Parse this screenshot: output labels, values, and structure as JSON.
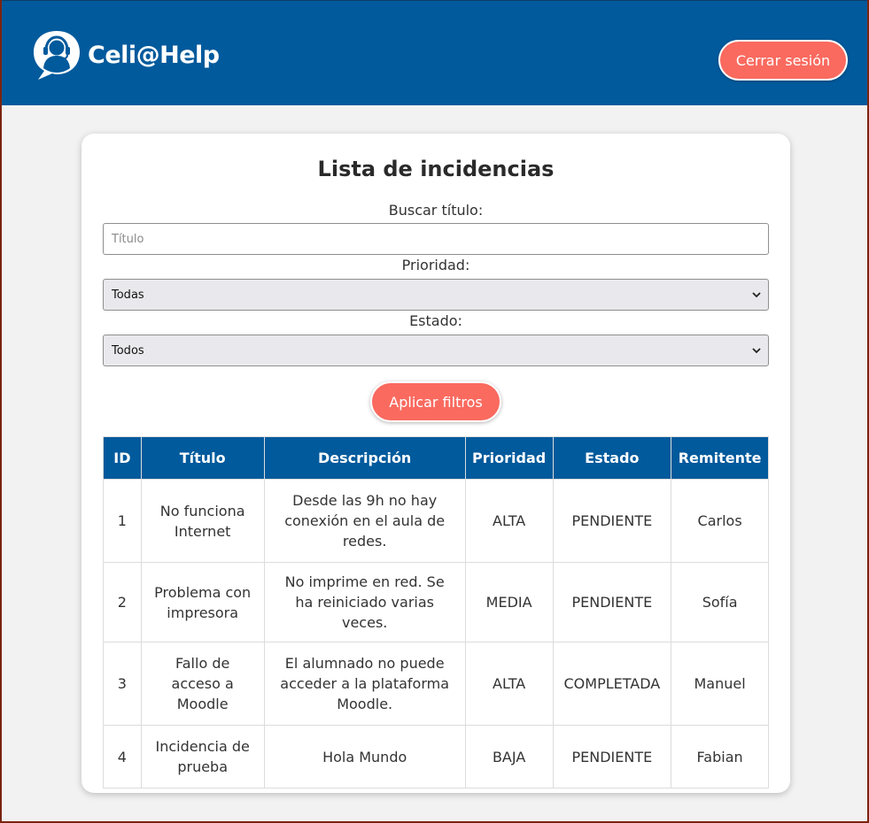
{
  "header": {
    "brand": "Celi@Help",
    "logout_label": "Cerrar sesión",
    "background_color": "#005a9c",
    "accent_color": "#fa6a5f"
  },
  "card": {
    "title": "Lista de incidencias",
    "search": {
      "label": "Buscar título:",
      "placeholder": "Título",
      "value": ""
    },
    "priority": {
      "label": "Prioridad:",
      "selected": "Todas"
    },
    "status": {
      "label": "Estado:",
      "selected": "Todos"
    },
    "apply_label": "Aplicar filtros"
  },
  "table": {
    "columns": [
      "ID",
      "Título",
      "Descripción",
      "Prioridad",
      "Estado",
      "Remitente"
    ],
    "rows": [
      {
        "id": "1",
        "titulo": "No funciona Internet",
        "descripcion": "Desde las 9h no hay conexión en el aula de redes.",
        "prioridad": "ALTA",
        "estado": "PENDIENTE",
        "remitente": "Carlos"
      },
      {
        "id": "2",
        "titulo": "Problema con impresora",
        "descripcion": "No imprime en red. Se ha reiniciado varias veces.",
        "prioridad": "MEDIA",
        "estado": "PENDIENTE",
        "remitente": "Sofía"
      },
      {
        "id": "3",
        "titulo": "Fallo de acceso a Moodle",
        "descripcion": "El alumnado no puede acceder a la plataforma Moodle.",
        "prioridad": "ALTA",
        "estado": "COMPLETADA",
        "remitente": "Manuel"
      },
      {
        "id": "4",
        "titulo": "Incidencia de prueba",
        "descripcion": "Hola Mundo",
        "prioridad": "BAJA",
        "estado": "PENDIENTE",
        "remitente": "Fabian"
      }
    ]
  }
}
